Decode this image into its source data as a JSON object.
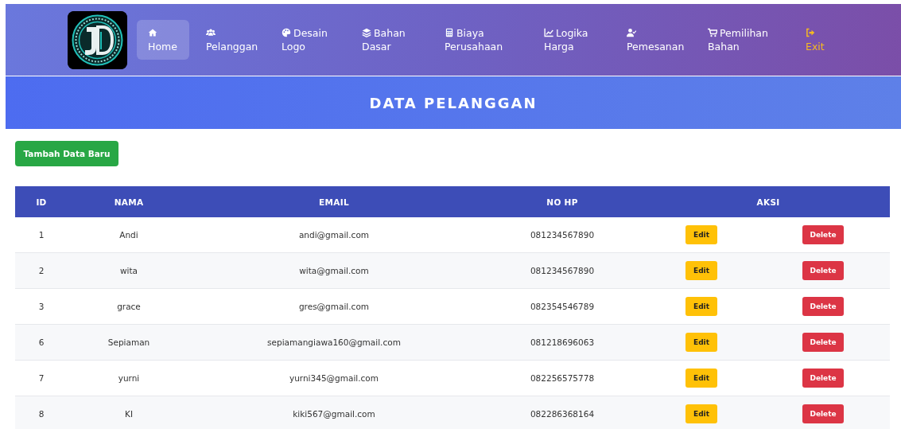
{
  "nav": {
    "items": [
      {
        "label": "Home",
        "selected": true,
        "kind": "link"
      },
      {
        "label": "Pelanggan",
        "selected": false,
        "kind": "link"
      },
      {
        "label": "Desain Logo",
        "selected": false,
        "kind": "link"
      },
      {
        "label": "Bahan Dasar",
        "selected": false,
        "kind": "link"
      },
      {
        "label": "Biaya Perusahaan",
        "selected": false,
        "kind": "link"
      },
      {
        "label": "Logika Harga",
        "selected": false,
        "kind": "link"
      },
      {
        "label": "Pemesanan",
        "selected": false,
        "kind": "link"
      },
      {
        "label": "Pemilihan Bahan",
        "selected": false,
        "kind": "link"
      },
      {
        "label": "Exit",
        "selected": false,
        "kind": "logout"
      }
    ]
  },
  "page_title": "DATA PELANGGAN",
  "add_button": "Tambah Data Baru",
  "table": {
    "columns": [
      "ID",
      "NAMA",
      "EMAIL",
      "NO HP",
      "AKSI"
    ],
    "rows": [
      {
        "id": "1",
        "nama": "Andi",
        "email": "andi@gmail.com",
        "no_hp": "081234567890",
        "edit": "Edit",
        "delete": "Delete"
      },
      {
        "id": "2",
        "nama": "wita",
        "email": "wita@gmail.com",
        "no_hp": "081234567890",
        "edit": "Edit",
        "delete": "Delete"
      },
      {
        "id": "3",
        "nama": "grace",
        "email": "gres@gmail.com",
        "no_hp": "082354546789",
        "edit": "Edit",
        "delete": "Delete"
      },
      {
        "id": "6",
        "nama": "Sepiaman",
        "email": "sepiamangiawa160@gmail.com",
        "no_hp": "081218696063",
        "edit": "Edit",
        "delete": "Delete"
      },
      {
        "id": "7",
        "nama": "yurni",
        "email": "yurni345@gmail.com",
        "no_hp": "082256575778",
        "edit": "Edit",
        "delete": "Delete"
      },
      {
        "id": "8",
        "nama": "KI",
        "email": "kiki567@gmail.com",
        "no_hp": "082286368164",
        "edit": "Edit",
        "delete": "Delete"
      }
    ]
  }
}
